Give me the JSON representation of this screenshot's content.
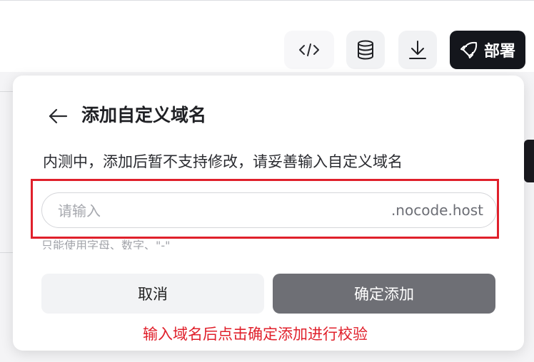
{
  "toolbar": {
    "code_icon": "code-icon",
    "database_icon": "database-icon",
    "download_icon": "download-icon",
    "deploy_icon": "rocket-icon",
    "deploy_label": "部署"
  },
  "dialog": {
    "title": "添加自定义域名",
    "description": "内测中，添加后暂不支持修改，请妥善输入自定义域名",
    "input_placeholder": "请输入",
    "input_value": "",
    "domain_suffix": ".nocode.host",
    "hint": "只能使用字母、数字、\"-\"",
    "cancel_label": "取消",
    "confirm_label": "确定添加"
  },
  "annotation": {
    "text": "输入域名后点击确定添加进行校验",
    "color": "#e0202b"
  }
}
